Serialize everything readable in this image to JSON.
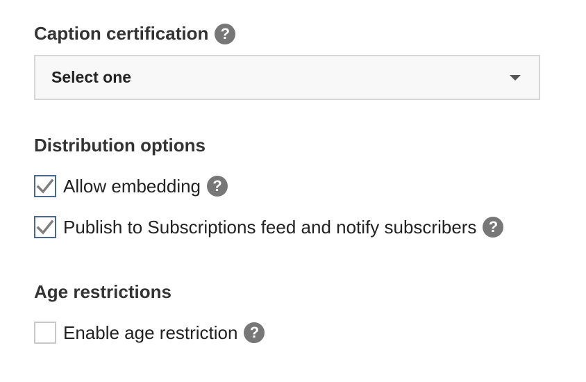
{
  "caption": {
    "title": "Caption certification",
    "select_value": "Select one"
  },
  "distribution": {
    "title": "Distribution options",
    "options": [
      {
        "label": "Allow embedding",
        "checked": true
      },
      {
        "label": "Publish to Subscriptions feed and notify subscribers",
        "checked": true
      }
    ]
  },
  "age": {
    "title": "Age restrictions",
    "options": [
      {
        "label": "Enable age restriction",
        "checked": false
      }
    ]
  },
  "icons": {
    "help": "question-circle-icon",
    "dropdown": "caret-down-icon",
    "check": "checkmark-icon"
  },
  "help_glyph": "?",
  "colors": {
    "checkbox_checked_border": "#4a6791",
    "checkbox_unchecked_border": "#c8c8c8",
    "checkmark": "#7f7f7f",
    "help_icon_bg": "#777777",
    "select_bg": "#f8f8f8",
    "select_border": "#d6d6d6"
  }
}
